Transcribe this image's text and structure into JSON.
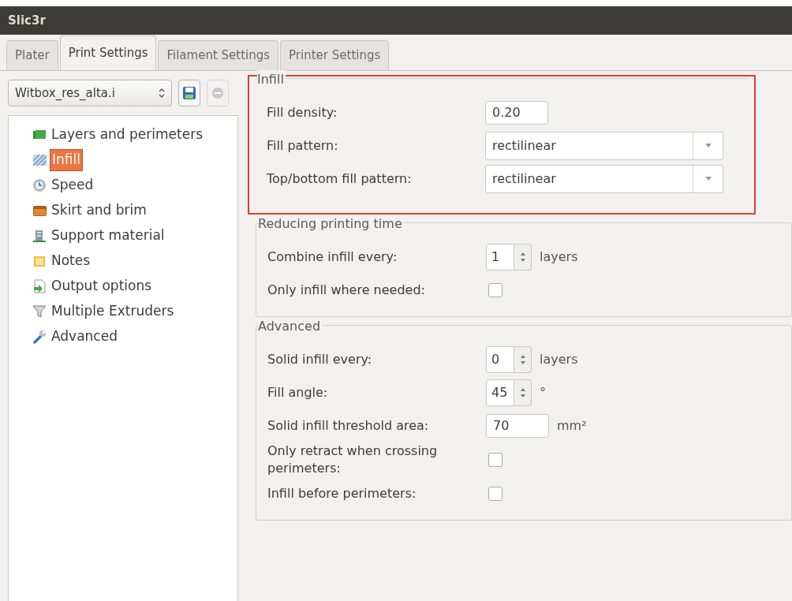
{
  "window": {
    "title": "Slic3r"
  },
  "tabs": [
    {
      "label": "Plater",
      "selected": false
    },
    {
      "label": "Print Settings",
      "selected": true
    },
    {
      "label": "Filament Settings",
      "selected": false
    },
    {
      "label": "Printer Settings",
      "selected": false
    }
  ],
  "preset": {
    "value": "Witbox_res_alta.i",
    "delete_disabled": true
  },
  "sidebar": {
    "items": [
      {
        "label": "Layers and perimeters",
        "selected": false
      },
      {
        "label": "Infill",
        "selected": true
      },
      {
        "label": "Speed",
        "selected": false
      },
      {
        "label": "Skirt and brim",
        "selected": false
      },
      {
        "label": "Support material",
        "selected": false
      },
      {
        "label": "Notes",
        "selected": false
      },
      {
        "label": "Output options",
        "selected": false
      },
      {
        "label": "Multiple Extruders",
        "selected": false
      },
      {
        "label": "Advanced",
        "selected": false
      }
    ]
  },
  "groups": [
    {
      "title": "Infill",
      "highlighted": true,
      "rows": [
        {
          "kind": "text",
          "label": "Fill density:",
          "value": "0.20"
        },
        {
          "kind": "combo",
          "label": "Fill pattern:",
          "value": "rectilinear"
        },
        {
          "kind": "combo",
          "label": "Top/bottom fill pattern:",
          "value": "rectilinear"
        }
      ]
    },
    {
      "title": "Reducing printing time",
      "highlighted": false,
      "rows": [
        {
          "kind": "spin",
          "label": "Combine infill every:",
          "value": "1",
          "unit": "layers"
        },
        {
          "kind": "checkbox",
          "label": "Only infill where needed:",
          "checked": false
        }
      ]
    },
    {
      "title": "Advanced",
      "highlighted": false,
      "rows": [
        {
          "kind": "spin",
          "label": "Solid infill every:",
          "value": "0",
          "unit": "layers"
        },
        {
          "kind": "spin",
          "label": "Fill angle:",
          "value": "45",
          "unit": "°"
        },
        {
          "kind": "text",
          "label": "Solid infill threshold area:",
          "value": "70",
          "unit": "mm²"
        },
        {
          "kind": "checkbox",
          "label": "Only retract when crossing perimeters:",
          "checked": false
        },
        {
          "kind": "checkbox",
          "label": "Infill before perimeters:",
          "checked": false
        }
      ]
    }
  ]
}
